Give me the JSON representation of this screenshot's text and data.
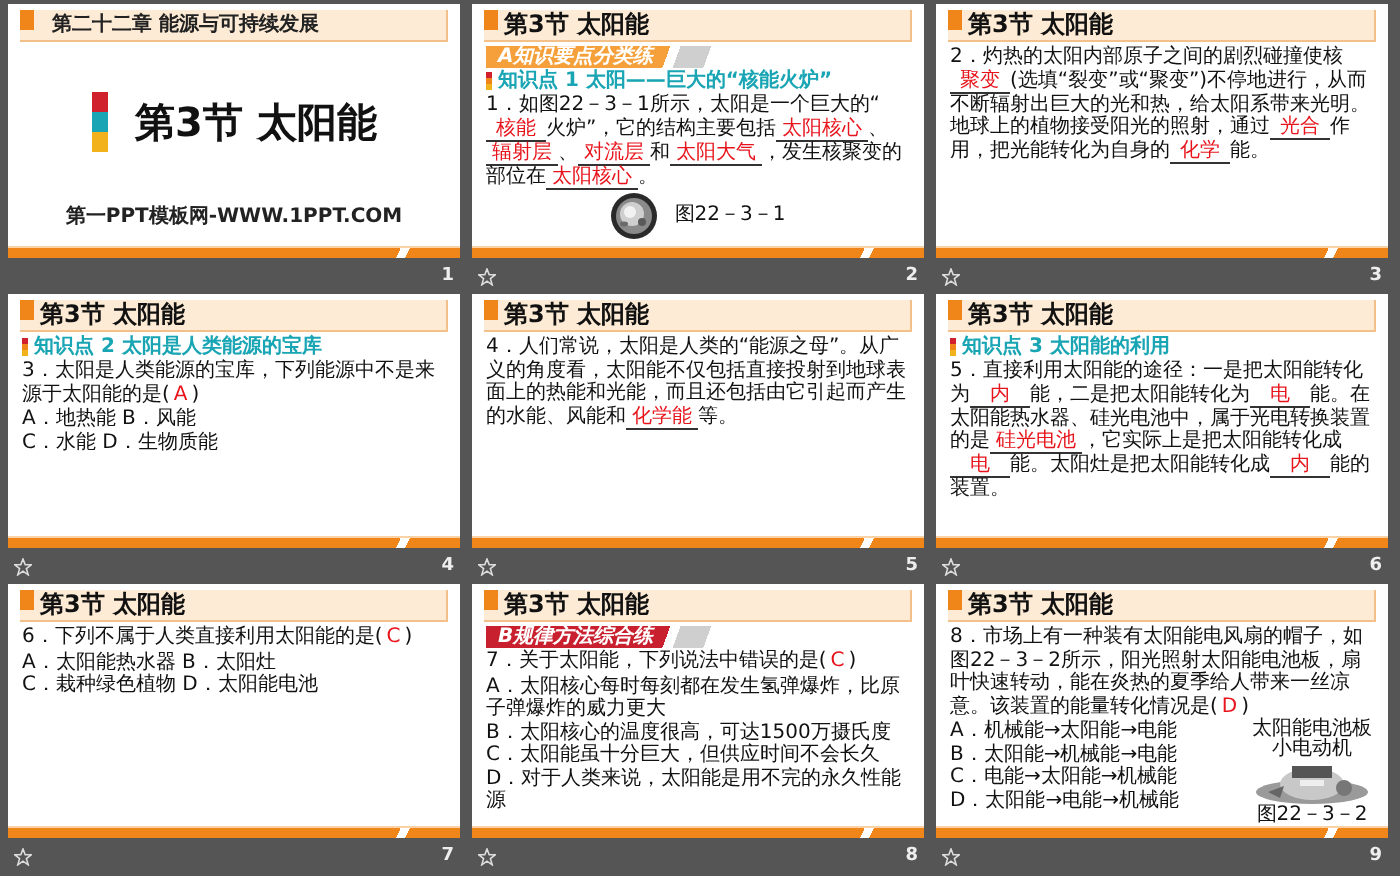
{
  "slides": [
    {
      "number": "1",
      "transition": false,
      "kind": "cover",
      "chapter": "第二十二章  能源与可持续发展",
      "title": "第3节  太阳能",
      "footer": "第一PPT模板网-WWW.1PPT.COM"
    },
    {
      "number": "2",
      "transition": true,
      "kind": "content",
      "title": "第3节  太阳能",
      "banner": {
        "text": "A知识要点分类练",
        "color": "#f5a03a"
      },
      "point": "知识点 1  太阳——巨大的“核能火炉”",
      "blocks": [
        {
          "kind": "paragraph",
          "parts": [
            {
              "kind": "text",
              "text": "1．如图22－3－1所示，太阳是一个巨大的“"
            },
            {
              "kind": "blank",
              "text": "核能"
            },
            {
              "kind": "text",
              "text": "火炉”，它的结构主要包括"
            },
            {
              "kind": "blank",
              "text": "太阳核心"
            },
            {
              "kind": "text",
              "text": "、"
            },
            {
              "kind": "blank",
              "text": "辐射层"
            },
            {
              "kind": "text",
              "text": "、"
            },
            {
              "kind": "blank",
              "text": "对流层"
            },
            {
              "kind": "text",
              "text": "和"
            },
            {
              "kind": "blank",
              "text": "太阳大气"
            },
            {
              "kind": "text",
              "text": "，发生核聚变的部位在"
            },
            {
              "kind": "blank",
              "text": "太阳核心"
            },
            {
              "kind": "text",
              "text": "。"
            }
          ]
        },
        {
          "kind": "figure",
          "caption": "图22－3－1"
        }
      ]
    },
    {
      "number": "3",
      "transition": true,
      "kind": "content",
      "title": "第3节  太阳能",
      "blocks": [
        {
          "kind": "paragraph",
          "parts": [
            {
              "kind": "text",
              "text": "2．灼热的太阳内部原子之间的剧烈碰撞使核"
            },
            {
              "kind": "blank",
              "text": "聚变"
            },
            {
              "kind": "text",
              "text": "(选填“裂变”或“聚变”)不停地进行，从而不断辐射出巨大的光和热，给太阳系带来光明。地球上的植物接受阳光的照射，通过"
            },
            {
              "kind": "blank",
              "text": "光合"
            },
            {
              "kind": "text",
              "text": "作用，把光能转化为自身的"
            },
            {
              "kind": "blank",
              "text": "化学"
            },
            {
              "kind": "text",
              "text": "能。"
            }
          ]
        }
      ]
    },
    {
      "number": "4",
      "transition": true,
      "kind": "content",
      "title": "第3节  太阳能",
      "point": "知识点 2  太阳是人类能源的宝库",
      "blocks": [
        {
          "kind": "paragraph",
          "parts": [
            {
              "kind": "text",
              "text": "3．太阳是人类能源的宝库，下列能源中不是来源于太阳能的是("
            },
            {
              "kind": "answer",
              "text": "A"
            },
            {
              "kind": "text",
              "text": ")"
            }
          ]
        },
        {
          "kind": "choices",
          "options": [
            "A．地热能  B．风能",
            "C．水能  D．生物质能"
          ]
        }
      ]
    },
    {
      "number": "5",
      "transition": true,
      "kind": "content",
      "title": "第3节  太阳能",
      "blocks": [
        {
          "kind": "paragraph",
          "parts": [
            {
              "kind": "text",
              "text": "4．人们常说，太阳是人类的“能源之母”。从广义的角度看，太阳能不仅包括直接投射到地球表面上的热能和光能，而且还包括由它引起而产生的水能、风能和"
            },
            {
              "kind": "blank",
              "text": "化学能"
            },
            {
              "kind": "text",
              "text": "等。"
            }
          ]
        }
      ]
    },
    {
      "number": "6",
      "transition": true,
      "kind": "content",
      "title": "第3节  太阳能",
      "point": "知识点 3  太阳能的利用",
      "blocks": [
        {
          "kind": "paragraph",
          "parts": [
            {
              "kind": "text",
              "text": "5．直接利用太阳能的途径：一是把太阳能转化为"
            },
            {
              "kind": "blank",
              "text": "内"
            },
            {
              "kind": "text",
              "text": "能，二是把太阳能转化为"
            },
            {
              "kind": "blank",
              "text": "电"
            },
            {
              "kind": "text",
              "text": "能。在太阳能热水器、硅光电池中，属于光电转换装置的是"
            },
            {
              "kind": "blank",
              "text": "硅光电池"
            },
            {
              "kind": "text",
              "text": "，它实际上是把太阳能转化成"
            },
            {
              "kind": "blank",
              "text": "电"
            },
            {
              "kind": "text",
              "text": "能。太阳灶是把太阳能转化成"
            },
            {
              "kind": "blank",
              "text": "内"
            },
            {
              "kind": "text",
              "text": "能的装置。"
            }
          ]
        }
      ]
    },
    {
      "number": "7",
      "transition": true,
      "kind": "content",
      "title": "第3节  太阳能",
      "blocks": [
        {
          "kind": "paragraph",
          "parts": [
            {
              "kind": "text",
              "text": "6．下列不属于人类直接利用太阳能的是("
            },
            {
              "kind": "answer",
              "text": "C"
            },
            {
              "kind": "text",
              "text": ")"
            }
          ]
        },
        {
          "kind": "choices",
          "options": [
            "A．太阳能热水器  B．太阳灶",
            "C．栽种绿色植物  D．太阳能电池"
          ]
        }
      ]
    },
    {
      "number": "8",
      "transition": true,
      "kind": "content",
      "title": "第3节  太阳能",
      "banner": {
        "text": "B规律方法综合练",
        "color": "#c8202e"
      },
      "blocks": [
        {
          "kind": "paragraph",
          "parts": [
            {
              "kind": "text",
              "text": "7．关于太阳能，下列说法中错误的是("
            },
            {
              "kind": "answer",
              "text": "C"
            },
            {
              "kind": "text",
              "text": ")"
            }
          ]
        },
        {
          "kind": "choices",
          "options": [
            "A．太阳核心每时每刻都在发生氢弹爆炸，比原子弹爆炸的威力更大",
            "B．太阳核心的温度很高，可达1500万摄氏度",
            "C．太阳能虽十分巨大，但供应时间不会长久",
            "D．对于人类来说，太阳能是用不完的永久性能源"
          ]
        }
      ]
    },
    {
      "number": "9",
      "transition": true,
      "kind": "content",
      "title": "第3节  太阳能",
      "blocks": [
        {
          "kind": "paragraph",
          "parts": [
            {
              "kind": "text",
              "text": "8．市场上有一种装有太阳能电风扇的帽子，如图22－3－2所示，阳光照射太阳能电池板，扇叶快速转动，能在炎热的夏季给人带来一丝凉意。该装置的能量转化情况是("
            },
            {
              "kind": "answer",
              "text": "D"
            },
            {
              "kind": "text",
              "text": ")"
            }
          ]
        },
        {
          "kind": "choices",
          "options": [
            "A．机械能→太阳能→电能",
            "B．太阳能→机械能→电能",
            "C．电能→太阳能→机械能",
            "D．太阳能→电能→机械能"
          ],
          "figure": {
            "caption": "图22－3－2",
            "labels": [
              "太阳能电池板",
              "小电动机"
            ]
          }
        }
      ]
    }
  ]
}
